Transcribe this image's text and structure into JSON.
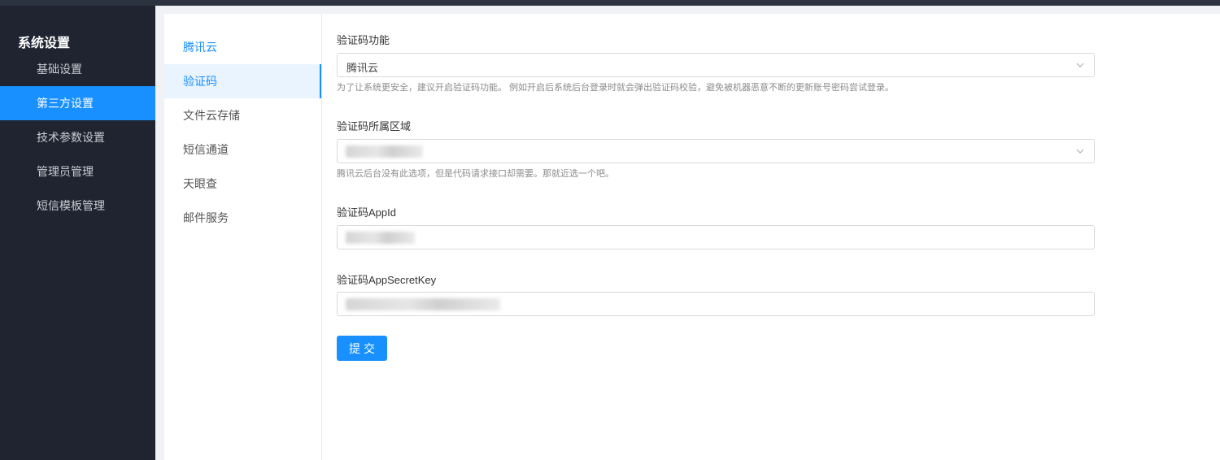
{
  "sidebar": {
    "title": "系统设置",
    "items": [
      {
        "label": "基础设置"
      },
      {
        "label": "第三方设置",
        "active": true
      },
      {
        "label": "技术参数设置"
      },
      {
        "label": "管理员管理"
      },
      {
        "label": "短信模板管理"
      }
    ]
  },
  "subnav": {
    "items": [
      {
        "label": "腾讯云"
      },
      {
        "label": "验证码",
        "active": true
      },
      {
        "label": "文件云存储"
      },
      {
        "label": "短信通道"
      },
      {
        "label": "天眼查"
      },
      {
        "label": "邮件服务"
      }
    ]
  },
  "form": {
    "captcha_function": {
      "label": "验证码功能",
      "value": "腾讯云",
      "help": "为了让系统更安全，建议开启验证码功能。 例如开启后系统后台登录时就会弹出验证码校验，避免被机器恶意不断的更新账号密码尝试登录。"
    },
    "captcha_region": {
      "label": "验证码所属区域",
      "help": "腾讯云后台没有此选项，但是代码请求接口却需要。那就近选一个吧。"
    },
    "captcha_appid": {
      "label": "验证码AppId"
    },
    "captcha_secret": {
      "label": "验证码AppSecretKey"
    },
    "submit_label": "提交"
  },
  "colors": {
    "accent": "#1890ff",
    "sidebar_bg": "#1f2430"
  }
}
